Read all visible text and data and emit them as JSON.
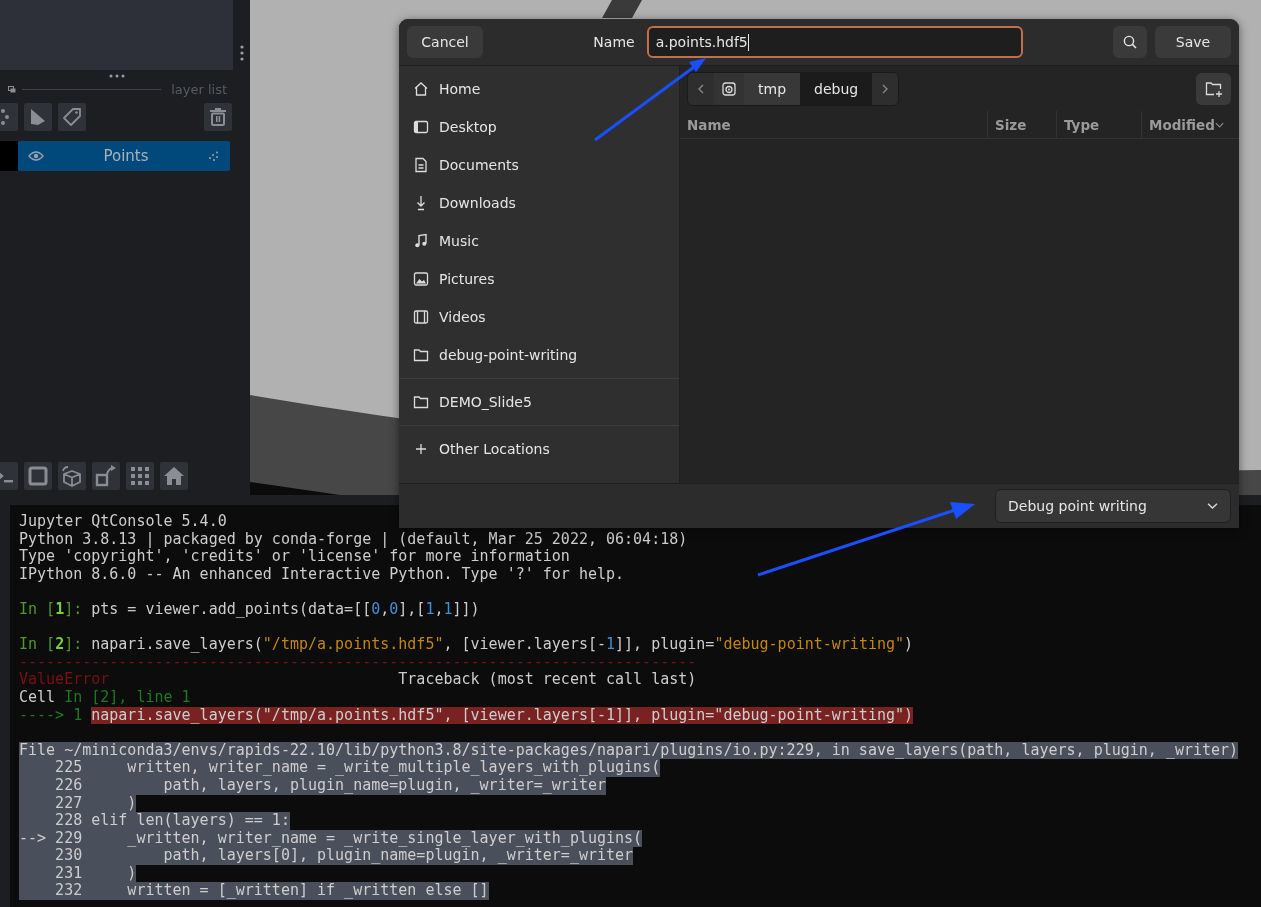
{
  "layer_panel": {
    "title": "layer list",
    "layers": [
      {
        "name": "Points",
        "visible": true,
        "selected": true
      }
    ]
  },
  "dialog": {
    "cancel": "Cancel",
    "name_label": "Name",
    "name_value": "a.points.hdf5",
    "save": "Save",
    "sections": [
      {
        "items": [
          {
            "label": "Home",
            "kind": "home"
          },
          {
            "label": "Desktop",
            "kind": "desktop"
          },
          {
            "label": "Documents",
            "kind": "documents"
          },
          {
            "label": "Downloads",
            "kind": "downloads"
          },
          {
            "label": "Music",
            "kind": "music"
          },
          {
            "label": "Pictures",
            "kind": "pictures"
          },
          {
            "label": "Videos",
            "kind": "videos"
          },
          {
            "label": "debug-point-writing",
            "kind": "folder"
          }
        ]
      },
      {
        "items": [
          {
            "label": "DEMO_Slide5",
            "kind": "folder"
          }
        ]
      },
      {
        "items": [
          {
            "label": "Other Locations",
            "kind": "other"
          }
        ]
      }
    ],
    "path": [
      {
        "kind": "drive",
        "selected": false
      },
      {
        "kind": "folder",
        "label": "tmp",
        "selected": false
      },
      {
        "kind": "folder",
        "label": "debug",
        "selected": true
      }
    ],
    "columns": [
      {
        "label": "Name",
        "sorted": false
      },
      {
        "label": "Size",
        "sorted": false
      },
      {
        "label": "Type",
        "sorted": false
      },
      {
        "label": "Modified",
        "sorted": true
      }
    ],
    "filter": "Debug point writing"
  },
  "console": {
    "lines": [
      {
        "kind": "text",
        "segments": [
          {
            "text": "Jupyter QtConsole 5.4.0",
            "kind": "plain"
          }
        ]
      },
      {
        "kind": "text",
        "segments": [
          {
            "text": "Python 3.8.13 | packaged by conda-forge | (default, Mar 25 2022, 06:04:18)",
            "kind": "plain"
          }
        ]
      },
      {
        "kind": "text",
        "segments": [
          {
            "text": "Type 'copyright', 'credits' or 'license' for more information",
            "kind": "plain"
          }
        ]
      },
      {
        "kind": "text",
        "segments": [
          {
            "text": "IPython 8.6.0 -- An enhanced Interactive Python. Type '?' for help.",
            "kind": "plain"
          }
        ]
      },
      {
        "kind": "blank"
      },
      {
        "kind": "text",
        "segments": [
          {
            "text": "In [",
            "kind": "prompt"
          },
          {
            "text": "1",
            "kind": "promptnum"
          },
          {
            "text": "]: ",
            "kind": "prompt"
          },
          {
            "text": "pts = viewer.add_points(data=[[",
            "kind": "plain"
          },
          {
            "text": "0",
            "kind": "num"
          },
          {
            "text": ",",
            "kind": "plain"
          },
          {
            "text": "0",
            "kind": "num"
          },
          {
            "text": "],[",
            "kind": "plain"
          },
          {
            "text": "1",
            "kind": "num"
          },
          {
            "text": ",",
            "kind": "plain"
          },
          {
            "text": "1",
            "kind": "num"
          },
          {
            "text": "]])",
            "kind": "plain"
          }
        ]
      },
      {
        "kind": "blank"
      },
      {
        "kind": "text",
        "segments": [
          {
            "text": "In [",
            "kind": "prompt"
          },
          {
            "text": "2",
            "kind": "promptnum"
          },
          {
            "text": "]: ",
            "kind": "prompt"
          },
          {
            "text": "napari.save_layers(",
            "kind": "plain"
          },
          {
            "text": "\"/tmp/a.points.hdf5\"",
            "kind": "str"
          },
          {
            "text": ", [viewer.layers[-",
            "kind": "plain"
          },
          {
            "text": "1",
            "kind": "num"
          },
          {
            "text": "]], plugin=",
            "kind": "plain"
          },
          {
            "text": "\"debug-point-writing\"",
            "kind": "str"
          },
          {
            "text": ")",
            "kind": "plain"
          }
        ]
      },
      {
        "kind": "text",
        "segments": [
          {
            "text": "---------------------------------------------------------------------------",
            "kind": "errname"
          }
        ]
      },
      {
        "kind": "text",
        "segments": [
          {
            "text": "ValueError",
            "kind": "errname"
          },
          {
            "text": "                                Traceback (most recent call last)",
            "kind": "plain"
          }
        ]
      },
      {
        "kind": "text",
        "segments": [
          {
            "text": "Cell ",
            "kind": "plain"
          },
          {
            "text": "In [2], line 1",
            "kind": "cellref"
          }
        ]
      },
      {
        "kind": "text",
        "segments": [
          {
            "text": "----> 1 ",
            "kind": "cellref"
          },
          {
            "text": "napari.save_layers(\"/tmp/a.points.hdf5\", [viewer.layers[-1]], plugin=\"debug-point-writing\")",
            "kind": "errcode"
          }
        ]
      },
      {
        "kind": "blank"
      },
      {
        "kind": "text",
        "segments": [
          {
            "text": "File ~/miniconda3/envs/rapids-22.10/lib/python3.8/site-packages/napari/plugins/io.py:229, in save_layers(path, layers, plugin, _writer)",
            "kind": "sel"
          }
        ]
      },
      {
        "kind": "text",
        "segments": [
          {
            "text": "    225     written, writer_name = _write_multiple_layers_with_plugins(",
            "kind": "sel"
          }
        ]
      },
      {
        "kind": "text",
        "segments": [
          {
            "text": "    226         path, layers, plugin_name=plugin, _writer=_writer",
            "kind": "sel"
          }
        ]
      },
      {
        "kind": "text",
        "segments": [
          {
            "text": "    227     )",
            "kind": "sel"
          }
        ]
      },
      {
        "kind": "text",
        "segments": [
          {
            "text": "    228 elif len(layers) == 1:",
            "kind": "sel"
          }
        ]
      },
      {
        "kind": "text",
        "segments": [
          {
            "text": "--> 229     _written, writer_name = _write_single_layer_with_plugins(",
            "kind": "sel"
          }
        ]
      },
      {
        "kind": "text",
        "segments": [
          {
            "text": "    230         path, layers[0], plugin_name=plugin, _writer=_writer",
            "kind": "sel"
          }
        ]
      },
      {
        "kind": "text",
        "segments": [
          {
            "text": "    231     )",
            "kind": "sel"
          }
        ]
      },
      {
        "kind": "text",
        "segments": [
          {
            "text": "    232     written = [_written] if _written else []",
            "kind": "sel"
          }
        ]
      }
    ]
  }
}
